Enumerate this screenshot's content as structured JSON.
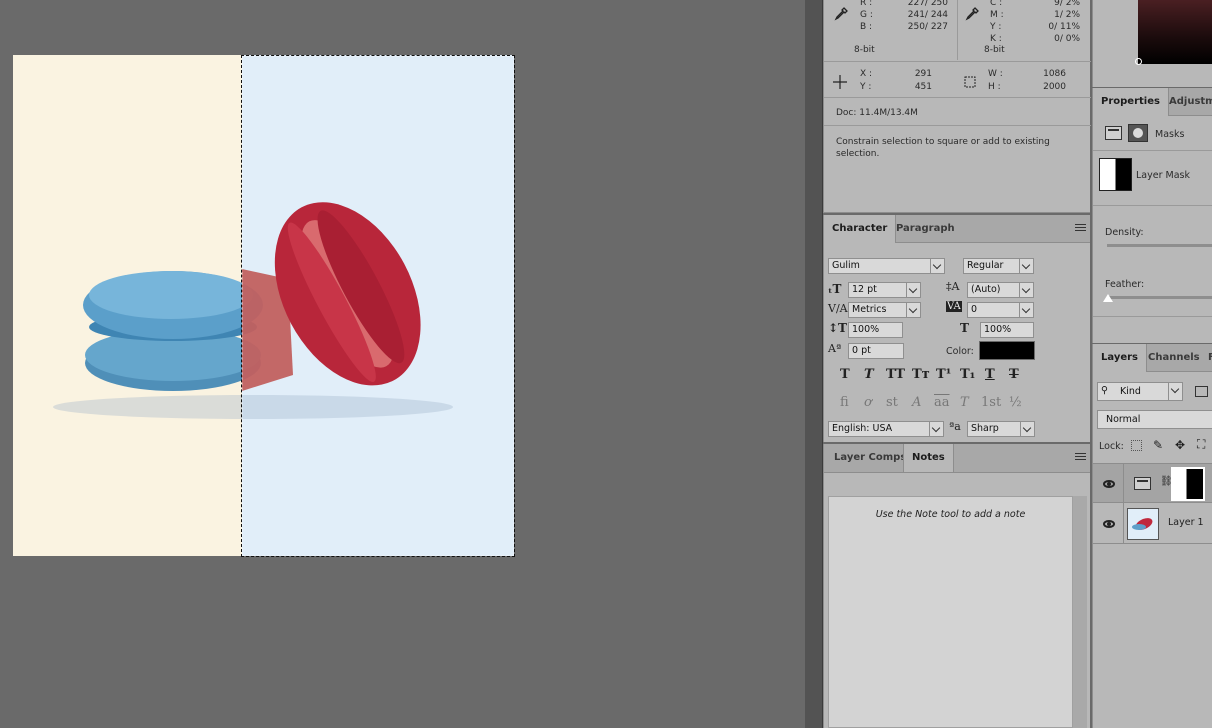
{
  "info": {
    "left": {
      "labels": [
        "R :",
        "G :",
        "B :"
      ],
      "values": [
        "227/ 250",
        "241/ 244",
        "250/ 227"
      ],
      "depth": "8-bit"
    },
    "right": {
      "labels": [
        "C :",
        "M :",
        "Y :",
        "K :"
      ],
      "values": [
        "9/  2%",
        "1/  2%",
        "0/  11%",
        "0/  0%"
      ],
      "depth": "8-bit"
    },
    "position": {
      "x_label": "X :",
      "y_label": "Y :",
      "x": "291",
      "y": "451"
    },
    "size": {
      "w_label": "W :",
      "h_label": "H :",
      "w": "1086",
      "h": "2000"
    },
    "doc": "Doc: 11.4M/13.4M",
    "hint": "Constrain selection to square or add to existing selection."
  },
  "character": {
    "tabs": [
      "Character",
      "Paragraph"
    ],
    "font_family": "Gulim",
    "font_style": "Regular",
    "size": "12 pt",
    "leading": "(Auto)",
    "kerning": "Metrics",
    "tracking": "0",
    "vscale": "100%",
    "hscale": "100%",
    "baseline": "0 pt",
    "color_label": "Color:",
    "color": "#000000",
    "language": "English: USA",
    "aa_symbol": "ªa",
    "antialias": "Sharp",
    "type_buttons": [
      "T",
      "T",
      "TT",
      "Tт",
      "T¹",
      "T₁",
      "T",
      "T"
    ],
    "opentype_buttons": [
      "ﬁ",
      "ơ",
      "st",
      "A",
      "aa",
      "T",
      "1st",
      "½"
    ]
  },
  "notes": {
    "tabs": [
      "Layer Comps",
      "Notes"
    ],
    "placeholder": "Use the Note tool to add a note"
  },
  "properties": {
    "tabs": [
      "Properties",
      "Adjustme"
    ],
    "masks_label": "Masks",
    "layer_mask_label": "Layer Mask",
    "density_label": "Density:",
    "feather_label": "Feather:"
  },
  "layers": {
    "tabs": [
      "Layers",
      "Channels",
      "F"
    ],
    "filter": "Kind",
    "blend": "Normal",
    "lock_label": "Lock:",
    "items": [
      {
        "name": "",
        "type": "adjustment"
      },
      {
        "name": "Layer 1",
        "type": "pixel"
      }
    ]
  },
  "colors": {
    "doc_left": "#faf3e1",
    "doc_right": "#e1eef9",
    "panel": "#b8b8b8"
  }
}
